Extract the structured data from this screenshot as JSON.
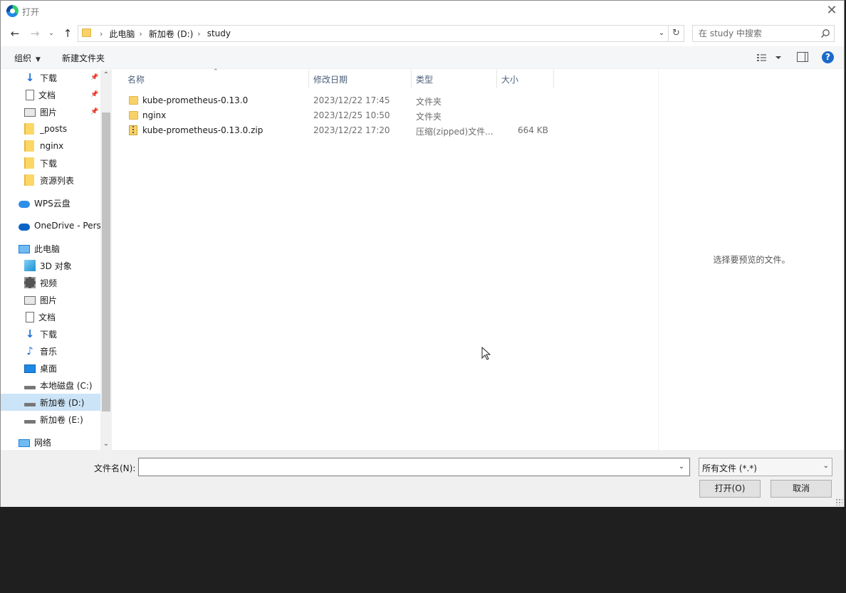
{
  "window": {
    "title": "打开"
  },
  "address": {
    "crumbs": [
      "此电脑",
      "新加卷 (D:)",
      "study"
    ]
  },
  "search": {
    "placeholder": "在 study 中搜索"
  },
  "toolbar": {
    "organize": "组织",
    "new_folder": "新建文件夹",
    "help": "?"
  },
  "sidebar": {
    "items": [
      {
        "label": "下载",
        "icon": "download-icon",
        "pinned": true
      },
      {
        "label": "文档",
        "icon": "document-icon",
        "pinned": true
      },
      {
        "label": "图片",
        "icon": "picture-icon",
        "pinned": true
      },
      {
        "label": "_posts",
        "icon": "folder-icon",
        "pinned": false
      },
      {
        "label": "nginx",
        "icon": "folder-icon",
        "pinned": false
      },
      {
        "label": "下载",
        "icon": "folder-icon",
        "pinned": false
      },
      {
        "label": "资源列表",
        "icon": "folder-icon",
        "pinned": false
      },
      {
        "label": "WPS云盘",
        "icon": "cloud-icon"
      },
      {
        "label": "OneDrive - Perso",
        "icon": "onedrive-icon"
      },
      {
        "label": "此电脑",
        "icon": "computer-icon"
      },
      {
        "label": "3D 对象",
        "icon": "3d-objects-icon"
      },
      {
        "label": "视频",
        "icon": "video-icon"
      },
      {
        "label": "图片",
        "icon": "picture-icon"
      },
      {
        "label": "文档",
        "icon": "document-icon"
      },
      {
        "label": "下载",
        "icon": "download-icon"
      },
      {
        "label": "音乐",
        "icon": "music-icon"
      },
      {
        "label": "桌面",
        "icon": "desktop-icon"
      },
      {
        "label": "本地磁盘 (C:)",
        "icon": "drive-icon"
      },
      {
        "label": "新加卷 (D:)",
        "icon": "drive-icon",
        "selected": true
      },
      {
        "label": "新加卷 (E:)",
        "icon": "drive-icon"
      },
      {
        "label": "网络",
        "icon": "network-icon"
      }
    ]
  },
  "columns": {
    "name": "名称",
    "modified": "修改日期",
    "type": "类型",
    "size": "大小"
  },
  "files": [
    {
      "name": "kube-prometheus-0.13.0",
      "modified": "2023/12/22 17:45",
      "type": "文件夹",
      "size": "",
      "icon": "folder-icon"
    },
    {
      "name": "nginx",
      "modified": "2023/12/25 10:50",
      "type": "文件夹",
      "size": "",
      "icon": "folder-icon"
    },
    {
      "name": "kube-prometheus-0.13.0.zip",
      "modified": "2023/12/22 17:20",
      "type": "压缩(zipped)文件...",
      "size": "664 KB",
      "icon": "zip-icon"
    }
  ],
  "preview": {
    "message": "选择要预览的文件。"
  },
  "footer": {
    "filename_label": "文件名(N):",
    "filename_value": "",
    "filter": "所有文件 (*.*)",
    "open": "打开(O)",
    "cancel": "取消"
  }
}
